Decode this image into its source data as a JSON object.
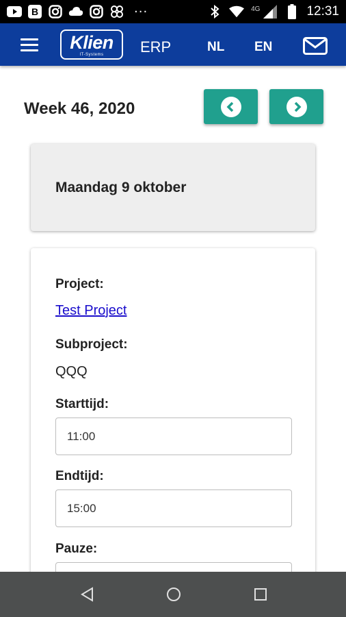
{
  "status_bar": {
    "time": "12:31",
    "network": "4G",
    "overflow": "···",
    "icons": [
      "youtube-icon",
      "b-icon",
      "instagram-icon",
      "cloud-icon",
      "instagram-icon",
      "fan-icon",
      "bluetooth-icon",
      "wifi-icon",
      "signal-icon",
      "battery-icon"
    ]
  },
  "app_bar": {
    "logo_main": "Klien",
    "logo_sub": "IT-Systems",
    "erp_label": "ERP",
    "nl_label": "NL",
    "en_label": "EN",
    "color": "#0d3d9c"
  },
  "week": {
    "title": "Week 46, 2020",
    "button_color": "#20a08e"
  },
  "day": {
    "title": "Maandag 9 oktober"
  },
  "form": {
    "project_label": "Project:",
    "project_value": "Test Project",
    "subproject_label": "Subproject:",
    "subproject_value": "QQQ",
    "start_label": "Starttijd:",
    "start_value": "11:00",
    "end_label": "Endtijd:",
    "end_value": "15:00",
    "pause_label": "Pauze:",
    "pause_value": ""
  }
}
